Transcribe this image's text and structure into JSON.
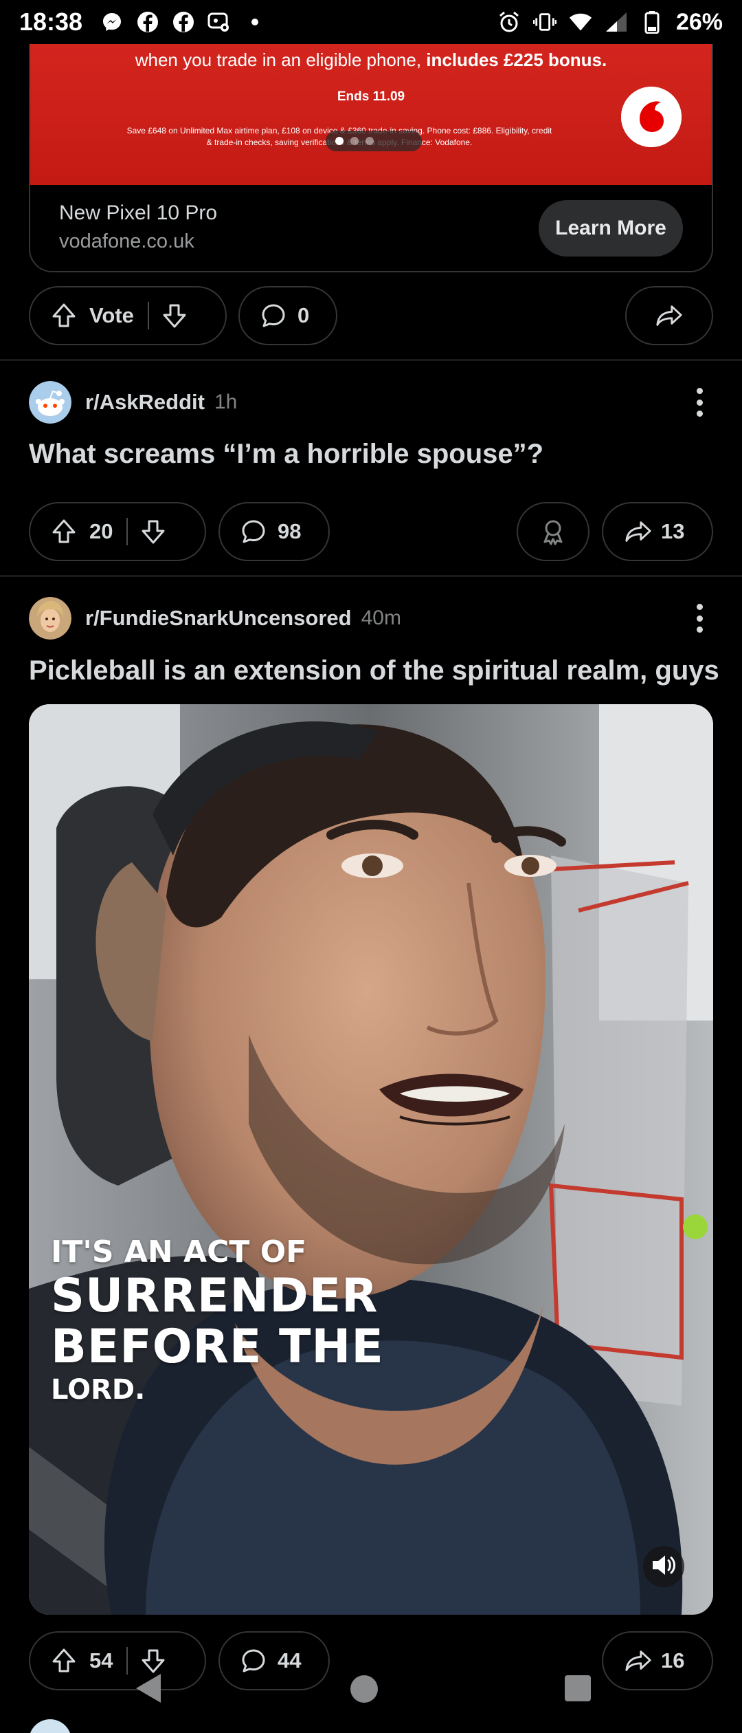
{
  "status_bar": {
    "time": "18:38",
    "battery": "26%",
    "left_icons": [
      "messenger-icon",
      "facebook-icon",
      "facebook-icon",
      "accessibility-icon",
      "dot-icon"
    ],
    "right_icons": [
      "alarm-icon",
      "vibrate-icon",
      "wifi-icon",
      "signal-icon",
      "battery-icon"
    ]
  },
  "ad": {
    "banner_line1_prefix": "when you trade in an eligible phone,",
    "banner_line1_bold": " includes £225 bonus.",
    "ends": "Ends 11.09",
    "fine_print": "Save £648 on Unlimited Max airtime plan, £108 on device & £360 trade-in saving. Phone cost: £886. Eligibility, credit & trade-in checks, saving verifications & terms apply. Finance: Vodafone.",
    "title": "New Pixel 10 Pro",
    "domain": "vodafone.co.uk",
    "cta": "Learn More",
    "brand_color": "#d3251e",
    "actions": {
      "vote_label": "Vote",
      "comments": "0"
    }
  },
  "posts": [
    {
      "subreddit": "r/AskReddit",
      "age": "1h",
      "title": "What screams “I’m a horrible spouse”?",
      "votes": "20",
      "comments": "98",
      "shares": "13"
    },
    {
      "subreddit": "r/FundieSnarkUncensored",
      "age": "40m",
      "title": "Pickleball is an extension of the spiritual realm, guys",
      "video_caption": {
        "line1": "IT'S AN ACT OF",
        "line2": "SURRENDER",
        "line3": "BEFORE THE",
        "line4": "LORD."
      },
      "votes": "54",
      "comments": "44",
      "shares": "16"
    }
  ],
  "colors": {
    "background": "#000000",
    "text": "#d7dadc",
    "muted": "#818384",
    "border": "#343536"
  }
}
